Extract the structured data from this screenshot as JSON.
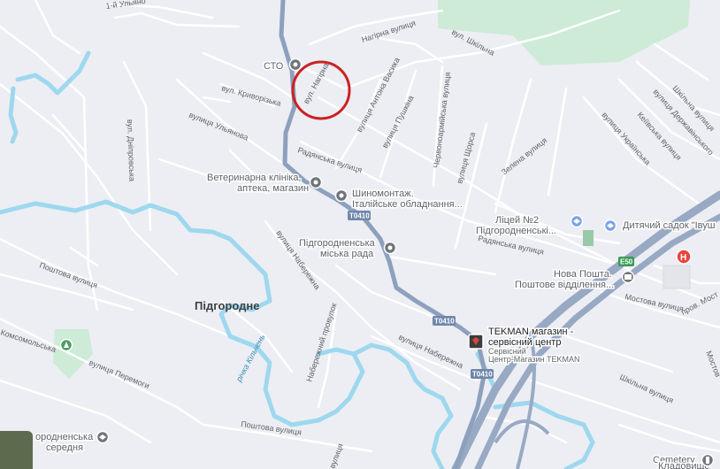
{
  "colors": {
    "background": "#eceef3",
    "road": "#ffffff",
    "main_road": "#8da0bd",
    "highway": "#98a9c4",
    "river": "#9ed8ef",
    "park": "#cdebd6",
    "poi_gray": "#70757a",
    "marker_red": "#cc2222",
    "hospital": "#e8453c",
    "school_blue": "#7aa4e6",
    "shop_dark": "#3c3c3c"
  },
  "places": {
    "town": "Підгородне"
  },
  "streets": {
    "s1": "1-й Ульяно",
    "s2": "Нагірна вулиця",
    "s3": "вул. Шкільна",
    "s4": "вул. Нагірна",
    "s5": "вул. Криворізька",
    "s6": "вулиця Антона Васика",
    "s7": "вулиця Пушкіна",
    "s8": "Червоноармійська вулиця",
    "s9": "вулиця Ульянова",
    "s10": "вул. Дніпровська",
    "s11": "Радянська вулиця",
    "s12": "вулиця Щорса",
    "s13": "Зелена вулиця",
    "s14": "вулиця Українська",
    "s15": "Кеіївська вулиця",
    "s16": "вулиця Державінського",
    "s17": "Шкільна вулиця",
    "s18": "Радянська вулиця",
    "s19": "вулиця Набережна",
    "s20": "Поштова вулиця",
    "s21": "Комсомольська",
    "s22": "вулиця Перемоги",
    "s23": "Набережний провулок",
    "s24": "вулиця Набережна",
    "s25": "Мостова вулиця",
    "s26": "пров. Мост",
    "s27": "Шкільна вулиця",
    "s28": "Мостов",
    "s29": "Поштова вулиця",
    "s30": "вулиця"
  },
  "rivers": {
    "r1": "річка Кільчень"
  },
  "shields": {
    "t1": "T0410",
    "t2": "T0410",
    "t3": "T0410",
    "e1": "E50"
  },
  "pois": {
    "sto": "СТО",
    "vet_line1": "Ветеринарна клініка,",
    "vet_line2": "аптека, магазин",
    "tire_line1": "Шиномонтаж.",
    "tire_line2": "Італійське обладнання...",
    "council_line1": "Підгородненська",
    "council_line2": "міська рада",
    "lyceum_line1": "Ліцей №2",
    "lyceum_line2": "Підгородненські...",
    "kinder": "Дитячий садок \"Івуш",
    "post_line1": "Нова Пошта.",
    "post_line2": "Поштове відділення...",
    "tekman_line1": "TEKMAN магазин -",
    "tekman_line2": "сервісний центр",
    "tekman_sub1": "Сервісний",
    "tekman_sub2": "Центр-Магазин TEKMAN",
    "school_line1": "ородненська",
    "school_line2": "середня",
    "cemetery_line1": "Cemetery",
    "cemetery_line2": "Кладовище"
  }
}
